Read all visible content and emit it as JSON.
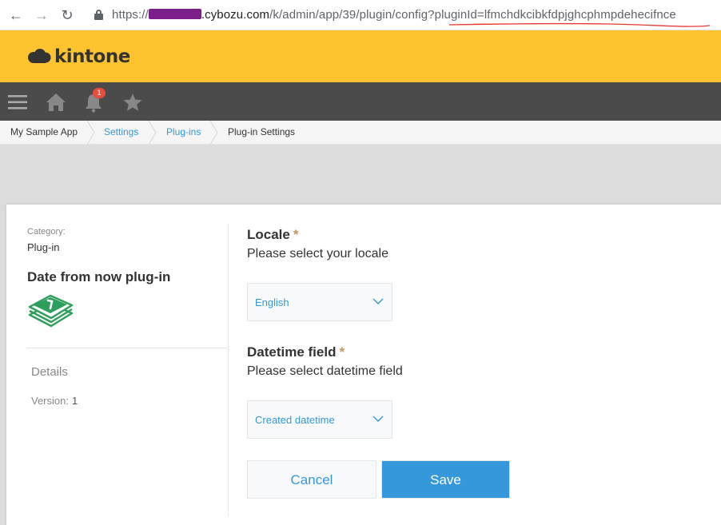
{
  "browser": {
    "back_icon": "arrow-back-icon",
    "forward_icon": "arrow-forward-icon",
    "reload_icon": "reload-icon",
    "url_prefix": "https://",
    "url_domain": ".cybozu.com",
    "url_path": "/k/admin/app/39/plugin/config?",
    "url_query": "pluginId=lfmchdkcibkfdpjghcphmpdehecifnce"
  },
  "header": {
    "logo_text": "kintone",
    "brand_color": "#fdc42f"
  },
  "toolbar": {
    "notification_count": "1",
    "icons": [
      "menu-icon",
      "home-icon",
      "bell-icon",
      "star-icon"
    ]
  },
  "breadcrumb": {
    "items": [
      "My Sample App",
      "Settings",
      "Plug-ins",
      "Plug-in Settings"
    ]
  },
  "plugin_info": {
    "category_label": "Category:",
    "category_value": "Plug-in",
    "name": "Date from now plug-in",
    "details_label": "Details",
    "version_label": "Version:",
    "version_value": "1"
  },
  "form": {
    "locale": {
      "label": "Locale",
      "required_mark": "*",
      "description": "Please select your locale",
      "selected": "English"
    },
    "datetime_field": {
      "label": "Datetime field",
      "required_mark": "*",
      "description": "Please select datetime field",
      "selected": "Created datetime"
    },
    "cancel_label": "Cancel",
    "save_label": "Save"
  },
  "colors": {
    "accent": "#3498db",
    "required": "#c7915e",
    "toolbar": "#4b4b4b",
    "badge": "#e74c3c"
  }
}
